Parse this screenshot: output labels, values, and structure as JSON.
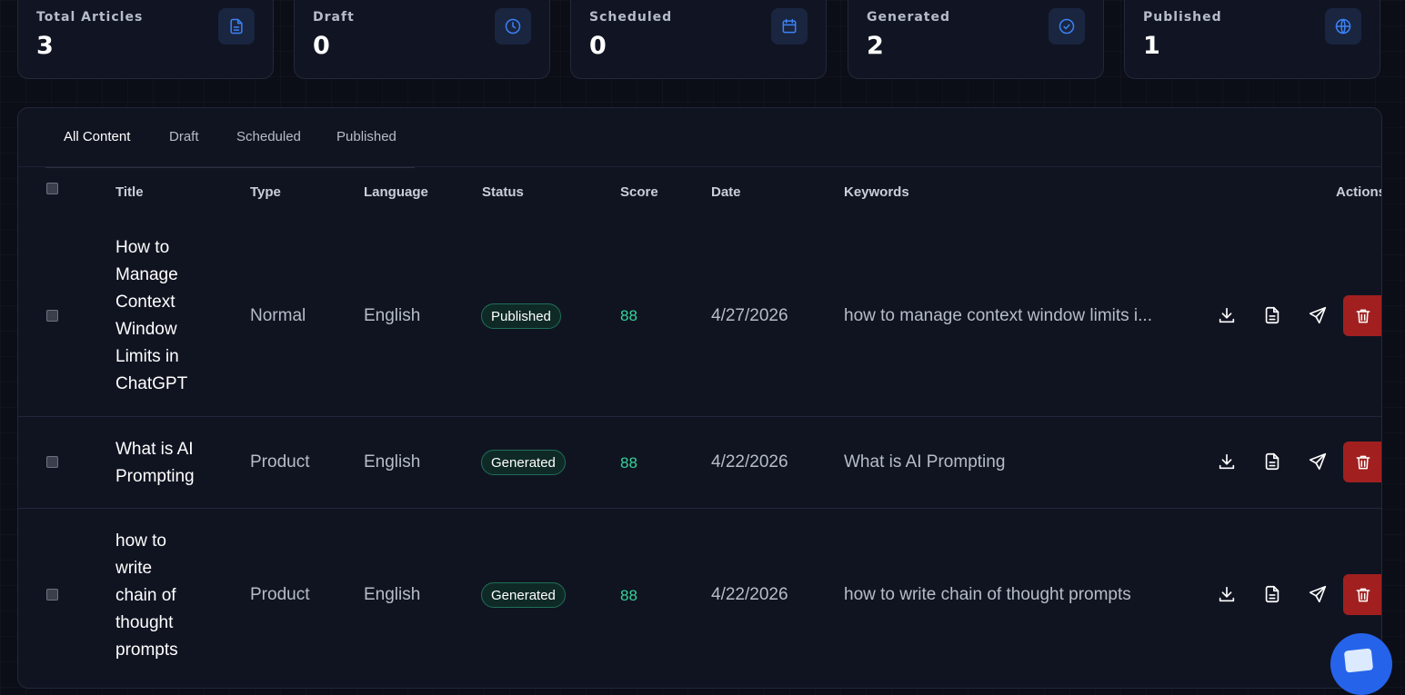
{
  "stats": [
    {
      "label": "Total Articles",
      "value": "3",
      "icon": "document-icon"
    },
    {
      "label": "Draft",
      "value": "0",
      "icon": "clock-icon"
    },
    {
      "label": "Scheduled",
      "value": "0",
      "icon": "calendar-icon"
    },
    {
      "label": "Generated",
      "value": "2",
      "icon": "check-circle-icon"
    },
    {
      "label": "Published",
      "value": "1",
      "icon": "globe-icon"
    }
  ],
  "tabs": [
    "All Content",
    "Draft",
    "Scheduled",
    "Published"
  ],
  "active_tab": "All Content",
  "table": {
    "headers": {
      "title": "Title",
      "type": "Type",
      "language": "Language",
      "status": "Status",
      "score": "Score",
      "date": "Date",
      "keywords": "Keywords",
      "actions": "Actions"
    },
    "rows": [
      {
        "title_lines": [
          "How to",
          "Manage",
          "Context",
          "Window",
          "Limits in",
          "ChatGPT"
        ],
        "type": "Normal",
        "language": "English",
        "status": "Published",
        "score": "88",
        "date": "4/27/2026",
        "keywords": "how to manage context window limits i..."
      },
      {
        "title_lines": [
          "What is AI",
          "Prompting"
        ],
        "type": "Product",
        "language": "English",
        "status": "Generated",
        "score": "88",
        "date": "4/22/2026",
        "keywords": "What is AI Prompting"
      },
      {
        "title_lines": [
          "how to",
          "write",
          "chain of",
          "thought",
          "prompts"
        ],
        "type": "Product",
        "language": "English",
        "status": "Generated",
        "score": "88",
        "date": "4/22/2026",
        "keywords": "how to write chain of thought prompts"
      }
    ]
  },
  "colors": {
    "background": "#0b0e17",
    "card": "#111523",
    "accent_blue": "#3b82f6",
    "score_green": "#34d399",
    "delete_red": "#a1201f",
    "badge_border": "#1f6f58"
  },
  "actions": [
    "download-icon",
    "file-text-icon",
    "send-icon",
    "trash-icon"
  ],
  "chat_widget_icon": "chat-icon"
}
